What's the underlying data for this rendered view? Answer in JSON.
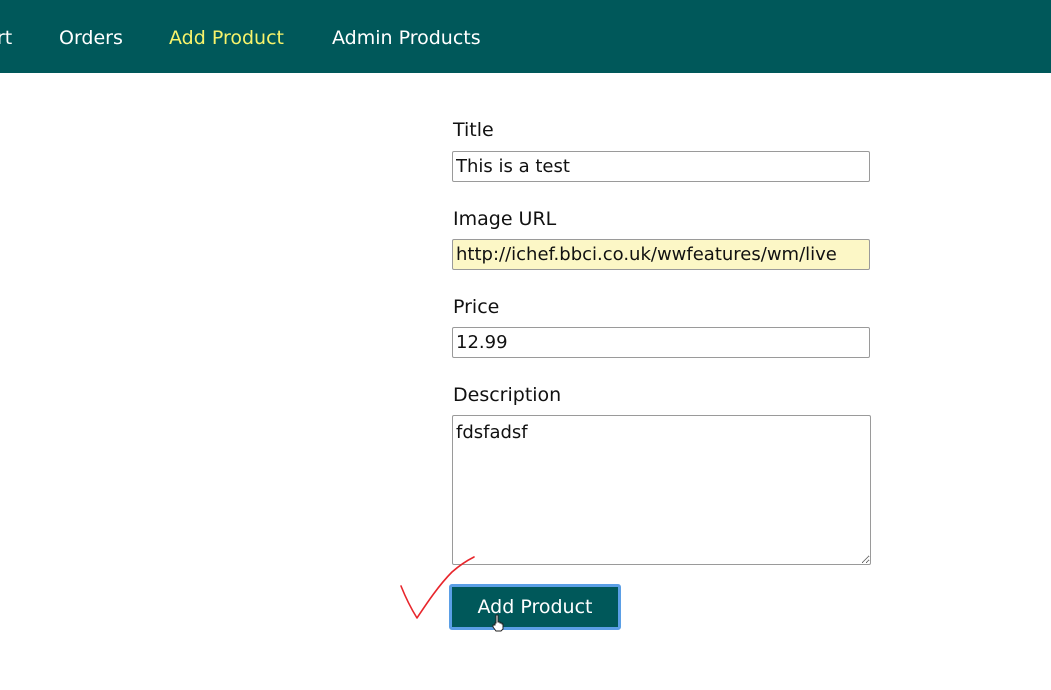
{
  "nav": {
    "items": [
      {
        "label": "rt",
        "active": false
      },
      {
        "label": "Orders",
        "active": false
      },
      {
        "label": "Add Product",
        "active": true
      },
      {
        "label": "Admin Products",
        "active": false
      }
    ],
    "bg_color": "#00585a",
    "active_color": "#f7f36b"
  },
  "form": {
    "title": {
      "label": "Title",
      "value": "This is a test"
    },
    "image_url": {
      "label": "Image URL",
      "value": "http://ichef.bbci.co.uk/wwfeatures/wm/live"
    },
    "price": {
      "label": "Price",
      "value": "12.99"
    },
    "description": {
      "label": "Description",
      "value": "fdsfadsf"
    },
    "submit_label": "Add Product"
  },
  "icons": {
    "annotation": "checkmark-annotation-icon",
    "cursor": "hand-cursor-icon"
  }
}
